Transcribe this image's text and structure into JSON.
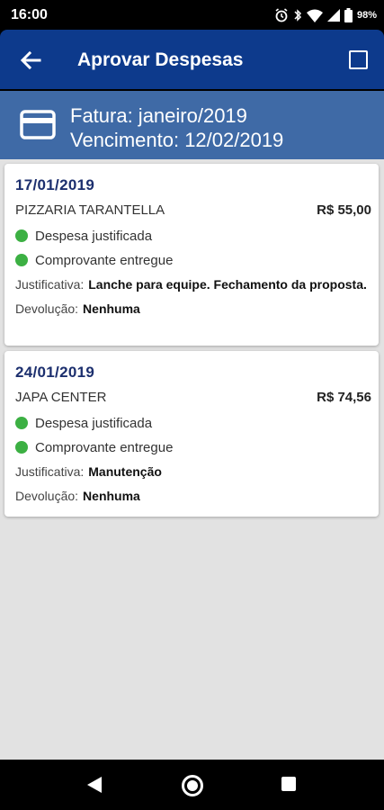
{
  "status_bar": {
    "time": "16:00",
    "battery_text": "98%",
    "icons": [
      "alarm-icon",
      "bluetooth-icon",
      "wifi-icon",
      "signal-icon",
      "battery-icon"
    ]
  },
  "app_bar": {
    "title": "Aprovar Despesas",
    "back_icon": "arrow-left-icon",
    "select_icon": "checkbox-icon"
  },
  "invoice": {
    "icon": "credit-card-icon",
    "fatura_line": "Fatura: janeiro/2019",
    "vencimento_line": "Vencimento: 12/02/2019"
  },
  "expenses": [
    {
      "date": "17/01/2019",
      "vendor": "PIZZARIA TARANTELLA",
      "amount": "R$ 55,00",
      "status_1": "Despesa justificada",
      "status_2": "Comprovante entregue",
      "justification_label": "Justificativa:",
      "justification_value": "Lanche para equipe. Fechamento da proposta.",
      "refund_label": "Devolução:",
      "refund_value": "Nenhuma"
    },
    {
      "date": "24/01/2019",
      "vendor": "JAPA CENTER",
      "amount": "R$ 74,56",
      "status_1": "Despesa justificada",
      "status_2": "Comprovante entregue",
      "justification_label": "Justificativa:",
      "justification_value": "Manutenção",
      "refund_label": "Devolução:",
      "refund_value": "Nenhuma"
    }
  ],
  "colors": {
    "app_bar": "#0d3a8c",
    "invoice_header": "#3f6aa6",
    "status_ok": "#3cb043",
    "date_text": "#1c2f6e",
    "background": "#e2e2e2"
  },
  "nav_bar": {
    "icons": [
      "back-triangle-icon",
      "home-circle-icon",
      "recents-square-icon"
    ]
  }
}
